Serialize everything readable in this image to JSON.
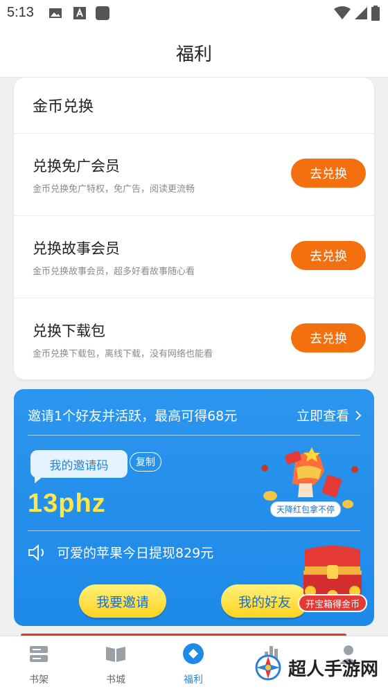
{
  "statusbar": {
    "time": "5:13"
  },
  "header": {
    "title": "福利"
  },
  "exchange": {
    "title": "金币兑换",
    "items": [
      {
        "title": "兑换免广会员",
        "desc": "金币兑换免广特权，免广告，阅读更流畅",
        "button": "去兑换"
      },
      {
        "title": "兑换故事会员",
        "desc": "金币兑换故事会员，超多好看故事随心看",
        "button": "去兑换"
      },
      {
        "title": "兑换下载包",
        "desc": "金币兑换下载包，离线下载，没有网络也能看",
        "button": "去兑换"
      }
    ]
  },
  "invite": {
    "headline": "邀请1个好友并活跃，最高可得68元",
    "view_more": "立即查看",
    "code_label": "我的邀请码",
    "copy": "复制",
    "code": "13phz",
    "promo_badge": "天降红包拿不停",
    "notice": "可爱的苹果今日提现829元",
    "invite_btn": "我要邀请",
    "friends_btn": "我的好友",
    "chest_label": "开宝箱得金币"
  },
  "nav": {
    "tabs": [
      {
        "label": "书架",
        "icon": "bookshelf-icon"
      },
      {
        "label": "书城",
        "icon": "book-icon"
      },
      {
        "label": "福利",
        "icon": "welfare-icon",
        "active": true
      }
    ]
  },
  "watermark": {
    "text": "超人手游网"
  },
  "colors": {
    "accent": "#1e8ae8",
    "orange": "#f4700f",
    "yellow": "#ffe74a"
  }
}
